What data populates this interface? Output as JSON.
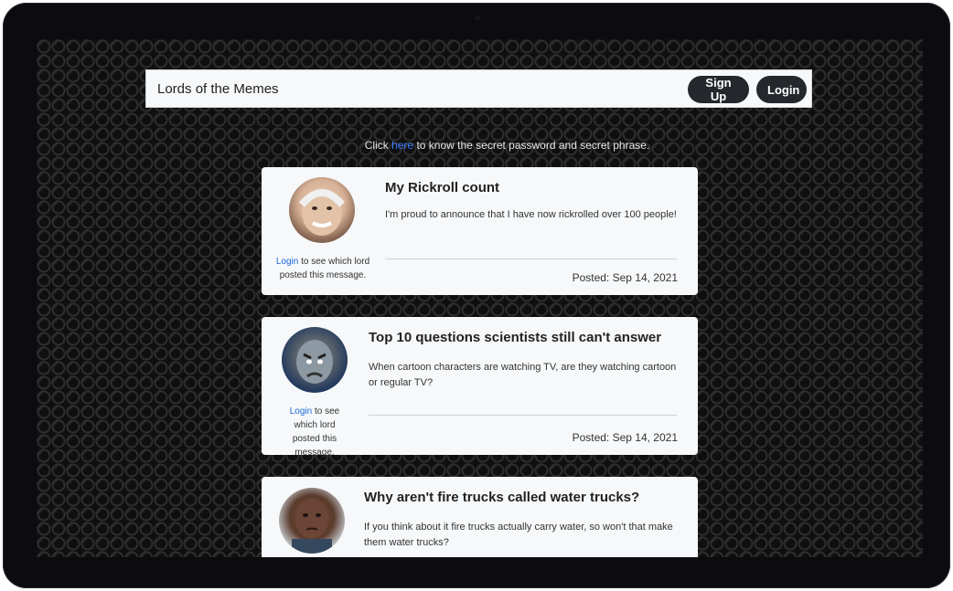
{
  "header": {
    "brand": "Lords of the Memes",
    "signup_label": "Sign Up",
    "login_label": "Login"
  },
  "notice": {
    "prefix": "Click ",
    "link": "here",
    "suffix": " to know the secret password and secret phrase."
  },
  "posts": [
    {
      "title": "My Rickroll count",
      "body": "I'm proud to announce that I have now rickrolled over 100 people!",
      "login_link": "Login",
      "login_suffix": " to see which lord posted this message.",
      "posted": "Posted: Sep 14, 2021"
    },
    {
      "title": "Top 10 questions scientists still can't answer",
      "body": "When cartoon characters are watching TV, are they watching cartoon or regular TV?",
      "login_link": "Login",
      "login_suffix": " to see which lord posted this message.",
      "posted": "Posted: Sep 14, 2021"
    },
    {
      "title": "Why aren't fire trucks called water trucks?",
      "body": "If you think about it fire trucks actually carry water, so won't that make them water trucks?"
    }
  ],
  "colors": {
    "button_bg": "#24272b",
    "link": "#1a6ad9",
    "card_bg": "#f6f8fa"
  }
}
